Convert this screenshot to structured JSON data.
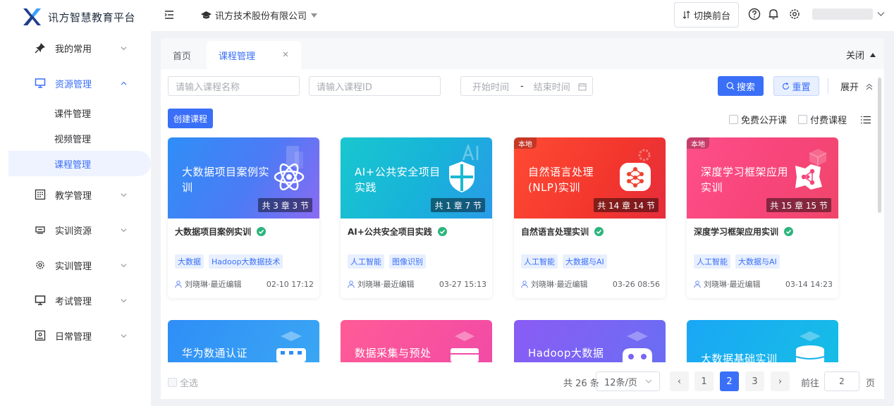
{
  "app": {
    "title": "讯方智慧教育平台",
    "org": "讯方技术股份有限公司",
    "switch_label": "切换前台"
  },
  "sidebar": {
    "items": [
      {
        "label": "我的常用",
        "icon": "pin-icon"
      },
      {
        "label": "资源管理",
        "icon": "monitor-icon"
      },
      {
        "label": "教学管理",
        "icon": "calendar-icon"
      },
      {
        "label": "实训资源",
        "icon": "screen-icon"
      },
      {
        "label": "实训管理",
        "icon": "gear-icon"
      },
      {
        "label": "考试管理",
        "icon": "monitor-icon"
      },
      {
        "label": "日常管理",
        "icon": "id-card-icon"
      }
    ],
    "sub_items": [
      "课件管理",
      "视频管理",
      "课程管理"
    ]
  },
  "tabs": {
    "home": "首页",
    "current": "课程管理",
    "close_all": "关闭"
  },
  "filters": {
    "name_placeholder": "请输入课程名称",
    "id_placeholder": "请输入课程ID",
    "start_placeholder": "开始时间",
    "range_sep": "-",
    "end_placeholder": "结束时间",
    "search_label": "搜索",
    "reset_label": "重置",
    "expand_label": "展开"
  },
  "toolbar": {
    "create_label": "创建课程",
    "free_label": "免费公开课",
    "paid_label": "付费课程"
  },
  "courses": [
    {
      "cover_title": "大数据项目案例实训",
      "chapters": "共 3 章 3 节",
      "title": "大数据项目案例实训",
      "tags": [
        "大数据",
        "Hadoop大数据技术"
      ],
      "author": "刘晓琳·最近编辑",
      "time": "02-10 17:12",
      "local": ""
    },
    {
      "cover_title": "AI+公共安全项目实践",
      "chapters": "共 1 章 7 节",
      "title": "AI+公共安全项目实践",
      "tags": [
        "人工智能",
        "图像识别"
      ],
      "author": "刘晓琳·最近编辑",
      "time": "03-27 15:13",
      "local": ""
    },
    {
      "cover_title": "自然语言处理(NLP)实训",
      "chapters": "共 14 章 14 节",
      "title": "自然语言处理实训",
      "tags": [
        "人工智能",
        "大数据与AI"
      ],
      "author": "刘晓琳·最近编辑",
      "time": "03-26 08:56",
      "local": "本地"
    },
    {
      "cover_title": "深度学习框架应用实训",
      "chapters": "共 15 章 15 节",
      "title": "深度学习框架应用实训",
      "tags": [
        "人工智能",
        "大数据与AI"
      ],
      "author": "刘晓琳·最近编辑",
      "time": "03-14 14:23",
      "local": "本地"
    }
  ],
  "courses_row2": [
    {
      "cover_title": "华为数通认证"
    },
    {
      "cover_title": "数据采集与预处"
    },
    {
      "cover_title": "Hadoop大数据"
    },
    {
      "cover_title": "大数据基础实训"
    }
  ],
  "footer": {
    "select_all": "全选",
    "total": "共 26 条",
    "page_size": "12条/页",
    "pages": [
      "1",
      "2",
      "3"
    ],
    "prev": "‹",
    "next": "›",
    "goto_label": "前往",
    "goto_value": "2",
    "goto_unit": "页"
  },
  "colors": {
    "accent": "#3a6ff7",
    "verified": "#2db47d"
  }
}
